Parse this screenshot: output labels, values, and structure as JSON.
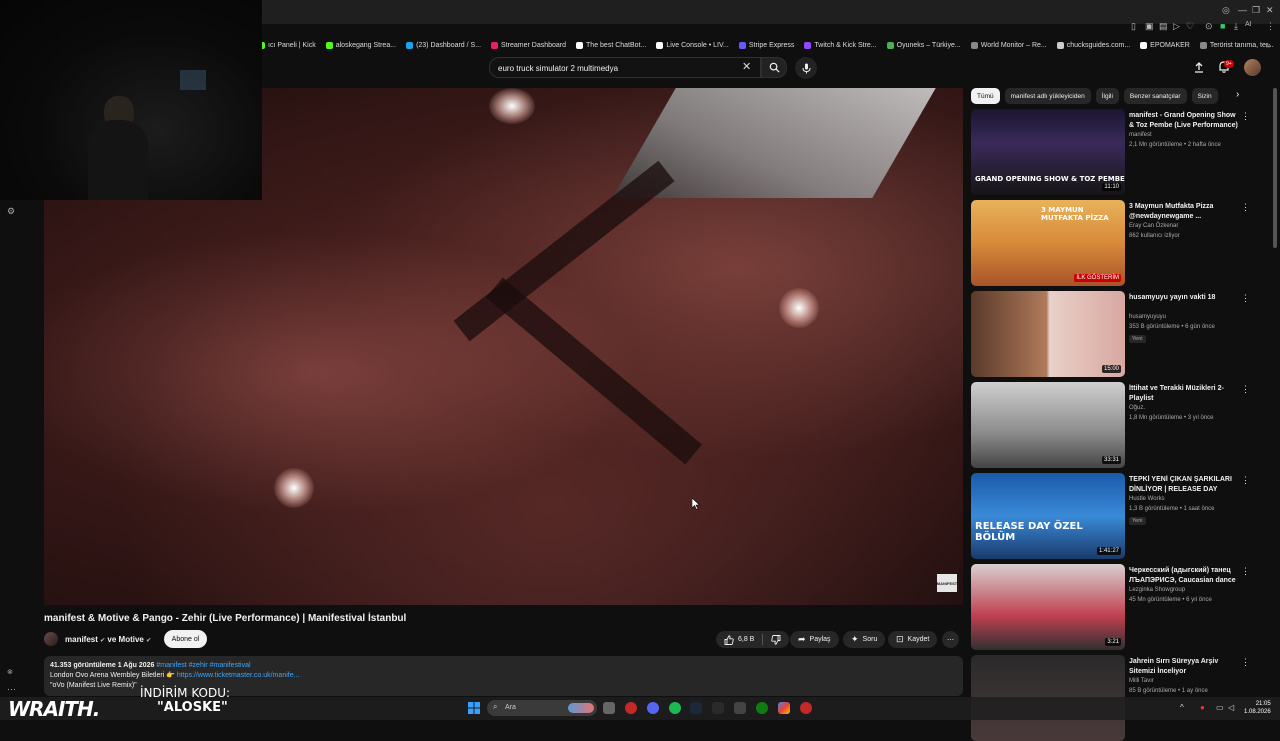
{
  "browser": {
    "bookmarks": [
      {
        "label": "ıcı Paneli | Kick",
        "color": "#53fc18"
      },
      {
        "label": "aloskegang Strea...",
        "color": "#53fc18"
      },
      {
        "label": "(23) Dashboard / S...",
        "color": "#1da1f2"
      },
      {
        "label": "Streamer Dashboard",
        "color": "#e91e63"
      },
      {
        "label": "The best ChatBot...",
        "color": "#ffffff"
      },
      {
        "label": "Live Console • LIV...",
        "color": "#ffffff"
      },
      {
        "label": "Stripe Express",
        "color": "#635bff"
      },
      {
        "label": "Twitch & Kick Stre...",
        "color": "#9146ff"
      },
      {
        "label": "Oyuneks – Türkiye...",
        "color": "#4caf50"
      },
      {
        "label": "World Monitor – Re...",
        "color": "#888888"
      },
      {
        "label": "chucksguides.com...",
        "color": "#cccccc"
      },
      {
        "label": "EPOMAKER",
        "color": "#ffffff"
      },
      {
        "label": "Terörist tanıma, ter...",
        "color": "#888888"
      }
    ],
    "ext_ai": "AI"
  },
  "header": {
    "search_value": "euro truck simulator 2 multimedya",
    "notif_count": "9+"
  },
  "video": {
    "title": "manifest & Motive & Pango - Zehir (Live Performance) | Manifestival İstanbul",
    "watermark": "MANIFEST",
    "channel": "manifest",
    "channel_and": "ve Motive",
    "subscribe": "Abone ol",
    "likes": "6,8 B",
    "share": "Paylaş",
    "ask": "Soru",
    "save": "Kaydet",
    "views_date": "41.353 görüntüleme  1 Ağu 2026",
    "tags": "#manifest #zehir #manifestival",
    "desc_line2": "London Ovo Arena Wembley Biletleri 👉",
    "desc_link": "https://www.ticketmaster.co.uk/manife...",
    "desc_line3": "\"oVo (Manifest Live Remix)\""
  },
  "sidebar": {
    "chips": [
      "Tümü",
      "manifest adlı yükleyiciden",
      "İlgili",
      "Benzer sanatçılar",
      "Sizin"
    ],
    "recommendations": [
      {
        "title": "manifest - Grand Opening Show & Toz Pembe (Live Performance) | ...",
        "channel": "manifest",
        "meta": "2,1 Mn görüntüleme • 2 hafta önce",
        "duration": "11:10",
        "thumb_text": "GRAND OPENING SHOW & TOZ PEMBE",
        "badge": ""
      },
      {
        "title": "3 Maymun Mutfakta Pizza @newdaynewgame ...",
        "channel": "Eray Can Özkenar",
        "meta": "862 kullanıcı izliyor",
        "duration": "İLK GÖSTERİM",
        "thumb_text": "3 MAYMUN MUTFAKTA PİZZA",
        "badge": ""
      },
      {
        "title": "husamyuyu yayın vakti 18",
        "channel": "husamyuyuyu",
        "meta": "353 B görüntüleme • 6 gün önce",
        "duration": "15:00",
        "thumb_text": "",
        "badge": "Yeni"
      },
      {
        "title": "İttihat ve Terakki Müzikleri 2- Playlist",
        "channel": "Oğuz.",
        "meta": "1,8 Mn görüntüleme • 3 yıl önce",
        "duration": "33:31",
        "thumb_text": "",
        "badge": ""
      },
      {
        "title": "TEPKİ YENİ ÇIKAN ŞARKILARI DİNLİYOR | RELEASE DAY @Tepki",
        "channel": "Hustle Works",
        "meta": "1,3 B görüntüleme • 1 saat önce",
        "duration": "1:41:27",
        "thumb_text": "RELEASE DAY ÖZEL BÖLÜM",
        "badge": "Yeni"
      },
      {
        "title": "Черкесский (адыгский) танец ЛЪАПЭРИСЭ, Caucasian dance",
        "channel": "Lezginka Showgroup",
        "meta": "45 Mn görüntüleme • 6 yıl önce",
        "duration": "3:21",
        "thumb_text": "",
        "badge": ""
      },
      {
        "title": "Jahrein Sırrı Süreyya Arşiv Sitemizi İnceliyor",
        "channel": "Milli Tavır",
        "meta": "85 B görüntüleme • 1 ay önce",
        "duration": "",
        "thumb_text": "",
        "badge": ""
      }
    ]
  },
  "overlay": {
    "brand": "WRAITH.",
    "promo_label": "İNDİRİM KODU:",
    "promo_code": "\"ALOSKE\""
  },
  "taskbar": {
    "search_placeholder": "Ara",
    "time": "21:05",
    "date": "1.08.2026"
  }
}
